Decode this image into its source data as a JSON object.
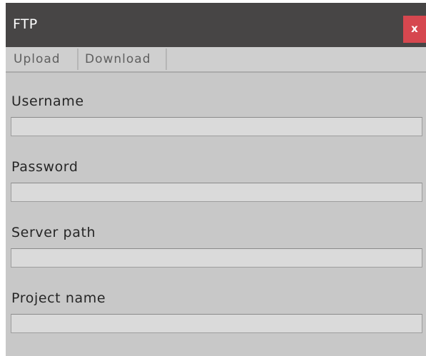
{
  "window": {
    "title": "FTP",
    "close_label": "x"
  },
  "toolbar": {
    "tabs": [
      {
        "label": "Upload"
      },
      {
        "label": "Download"
      }
    ]
  },
  "form": {
    "fields": [
      {
        "label": "Username",
        "value": ""
      },
      {
        "label": "Password",
        "value": ""
      },
      {
        "label": "Server path",
        "value": ""
      },
      {
        "label": "Project name",
        "value": ""
      }
    ]
  },
  "colors": {
    "titlebar": "#474545",
    "close_button": "#d6474f",
    "panel_background": "#c8c8c8",
    "input_background": "#dadada"
  }
}
